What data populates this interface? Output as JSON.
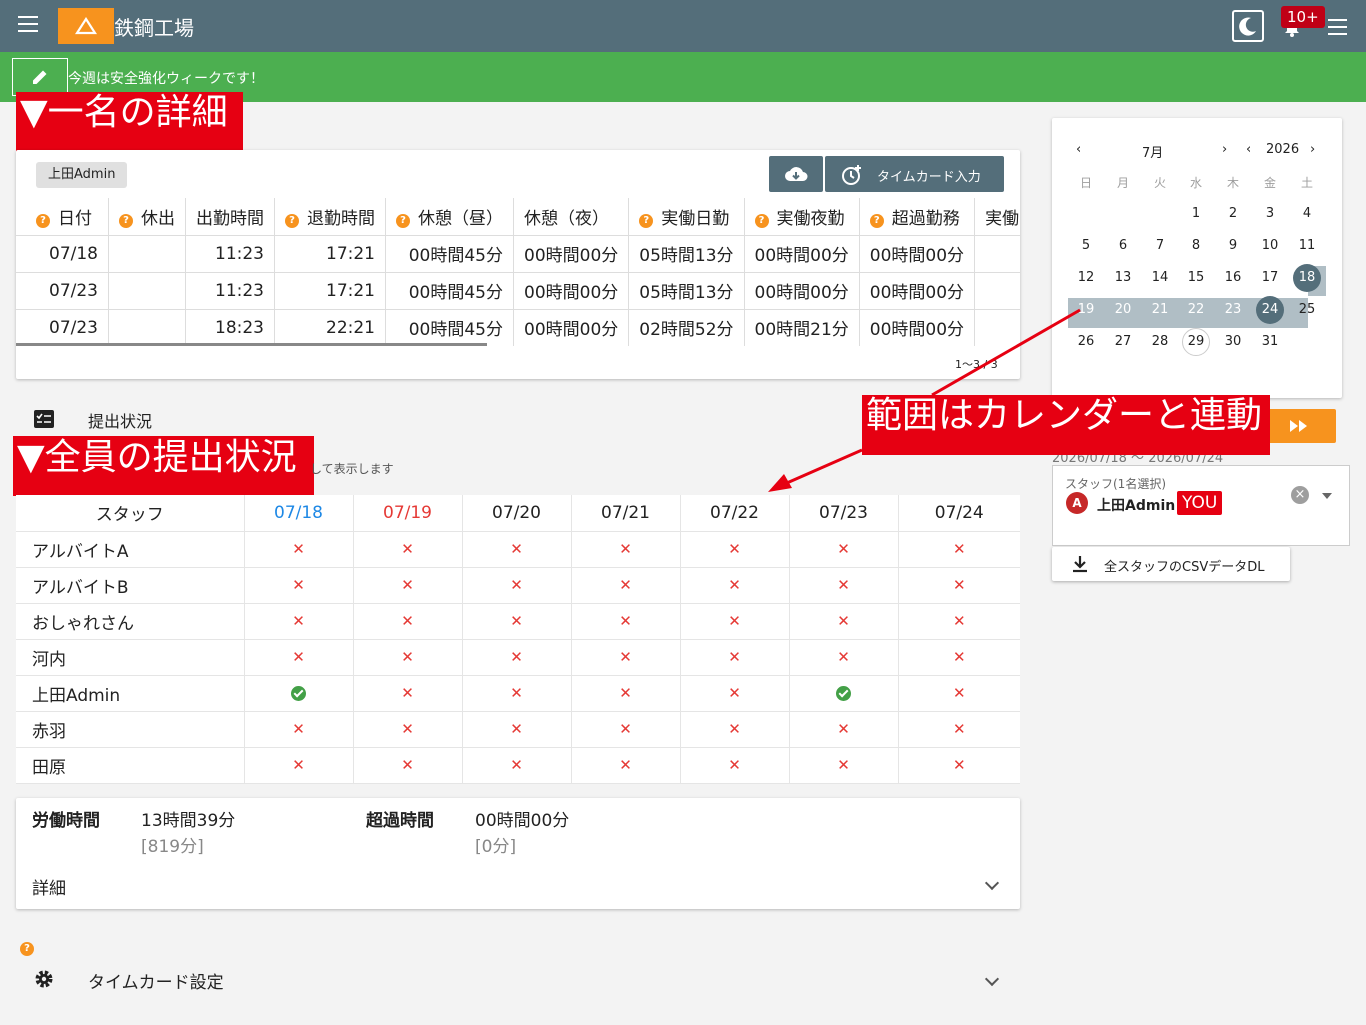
{
  "header": {
    "app_name": "鉄鋼工場",
    "badge": "10+"
  },
  "announcement": "今週は安全強化ウィークです！",
  "labels": {
    "detail_single": "▼一名の詳細",
    "all_status": "▼全員の提出状況",
    "range_linked": "範囲はカレンダーと連動"
  },
  "detail": {
    "user_chip": "上田Admin",
    "timecard_button": "タイムカード入力",
    "columns": [
      "日付",
      "休出",
      "出勤時間",
      "退勤時間",
      "休憩（昼）",
      "休憩（夜）",
      "実働日勤",
      "実働夜勤",
      "超過勤務",
      "実働"
    ],
    "rows": [
      [
        "07/18",
        "",
        "11:23",
        "17:21",
        "00時間45分",
        "00時間00分",
        "05時間13分",
        "00時間00分",
        "00時間00分",
        ""
      ],
      [
        "07/23",
        "",
        "11:23",
        "17:21",
        "00時間45分",
        "00時間00分",
        "05時間13分",
        "00時間00分",
        "00時間00分",
        ""
      ],
      [
        "07/23",
        "",
        "18:23",
        "22:21",
        "00時間45分",
        "00時間00分",
        "02時間52分",
        "00時間21分",
        "00時間00分",
        ""
      ]
    ],
    "pager": "1〜3 / 3"
  },
  "submission": {
    "title": "提出状況",
    "note": "して表示します",
    "staff_header": "スタッフ",
    "dates": [
      "07/18",
      "07/19",
      "07/20",
      "07/21",
      "07/22",
      "07/23",
      "07/24"
    ],
    "date_colors": [
      "#1e88e5",
      "#e53935",
      "#222222",
      "#222222",
      "#222222",
      "#222222",
      "#222222"
    ],
    "staff": [
      {
        "name": "アルバイトA",
        "marks": [
          "x",
          "x",
          "x",
          "x",
          "x",
          "x",
          "x"
        ]
      },
      {
        "name": "アルバイトB",
        "marks": [
          "x",
          "x",
          "x",
          "x",
          "x",
          "x",
          "x"
        ]
      },
      {
        "name": "おしゃれさん",
        "marks": [
          "x",
          "x",
          "x",
          "x",
          "x",
          "x",
          "x"
        ]
      },
      {
        "name": "河内",
        "marks": [
          "x",
          "x",
          "x",
          "x",
          "x",
          "x",
          "x"
        ]
      },
      {
        "name": "上田Admin",
        "marks": [
          "ok",
          "x",
          "x",
          "x",
          "x",
          "ok",
          "x"
        ]
      },
      {
        "name": "赤羽",
        "marks": [
          "x",
          "x",
          "x",
          "x",
          "x",
          "x",
          "x"
        ]
      },
      {
        "name": "田原",
        "marks": [
          "x",
          "x",
          "x",
          "x",
          "x",
          "x",
          "x"
        ]
      }
    ]
  },
  "summary": {
    "work_label": "労働時間",
    "work_value": "13時間39分",
    "work_sub": "[819分]",
    "over_label": "超過時間",
    "over_value": "00時間00分",
    "over_sub": "[0分]",
    "detail_label": "詳細"
  },
  "calendar": {
    "month": "7月",
    "year": "2026",
    "weekdays": [
      "日",
      "月",
      "火",
      "水",
      "木",
      "金",
      "土"
    ],
    "weeks": [
      [
        "",
        "",
        "",
        "1",
        "2",
        "3",
        "4"
      ],
      [
        "5",
        "6",
        "7",
        "8",
        "9",
        "10",
        "11"
      ],
      [
        "12",
        "13",
        "14",
        "15",
        "16",
        "17",
        "18"
      ],
      [
        "19",
        "20",
        "21",
        "22",
        "23",
        "24",
        "25"
      ],
      [
        "26",
        "27",
        "28",
        "29",
        "30",
        "31",
        ""
      ]
    ],
    "range_dates": "2026/07/18 〜 2026/07/24"
  },
  "staff_select": {
    "caption": "スタッフ(1名選択)",
    "avatar": "A",
    "name": "上田Admin",
    "you": "YOU"
  },
  "csv_button": "全スタッフのCSVデータDL",
  "timecard_settings": "タイムカード設定"
}
